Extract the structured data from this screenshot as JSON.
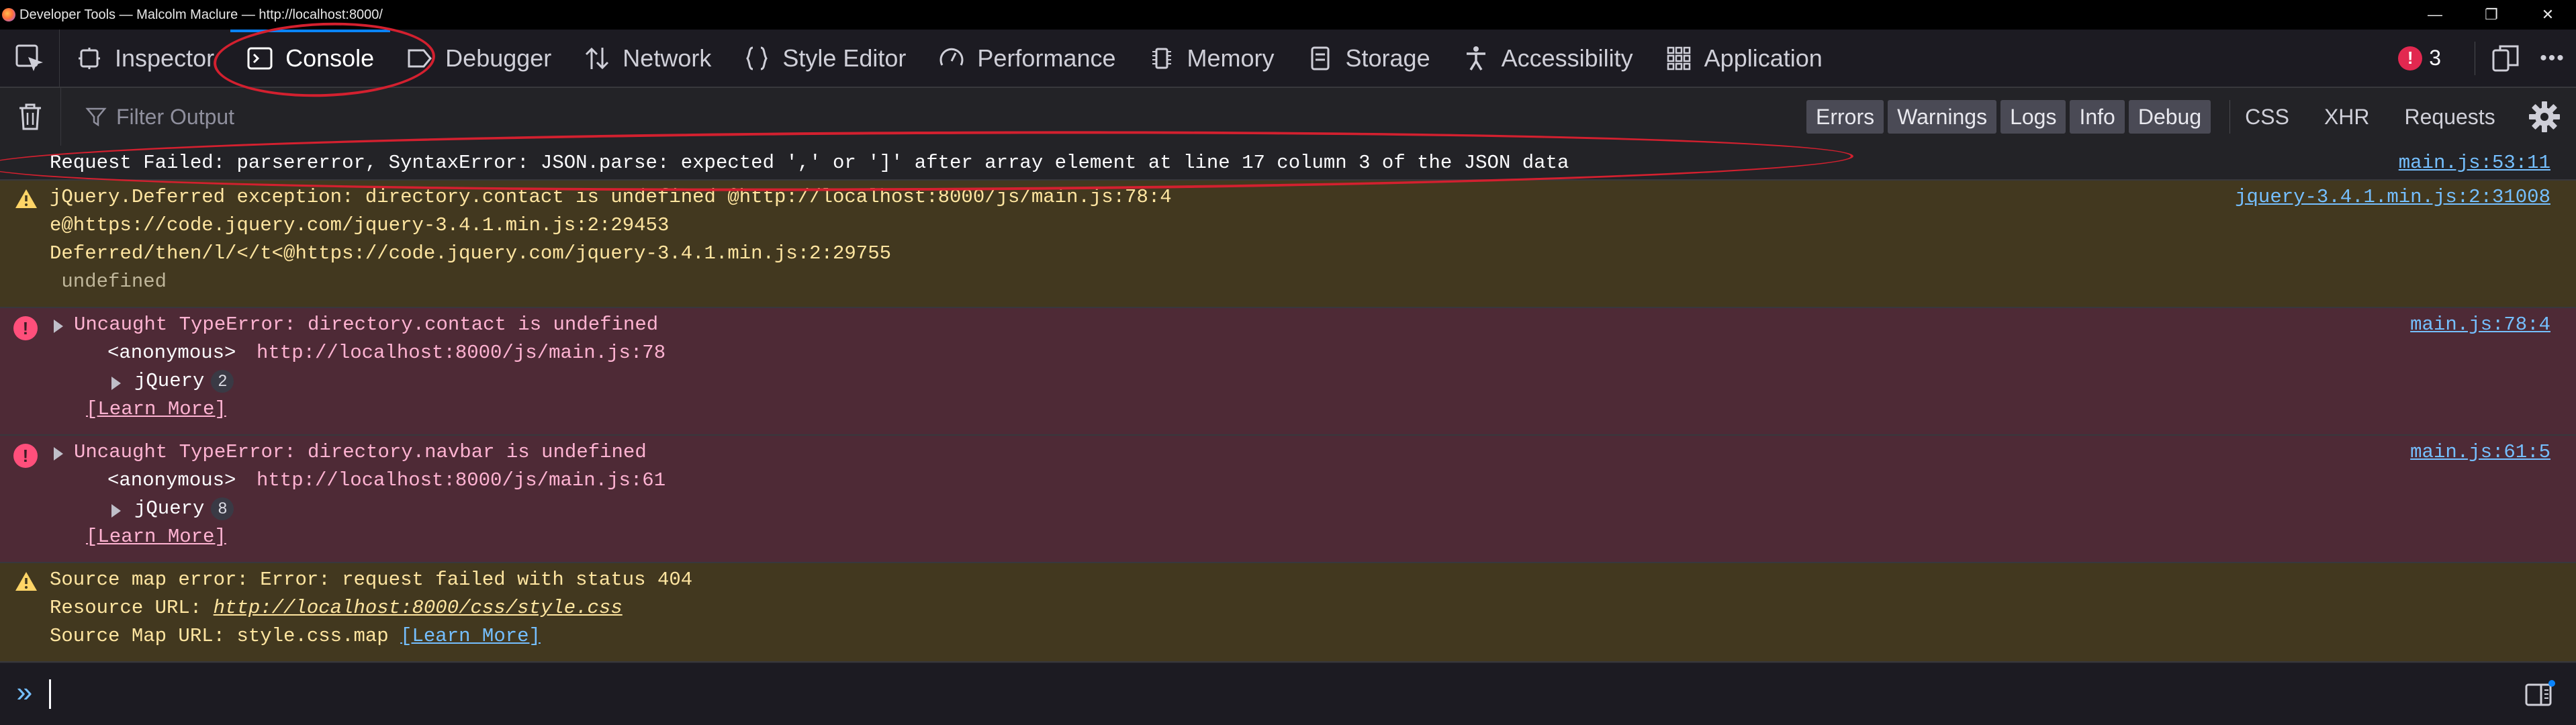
{
  "window": {
    "title": "Developer Tools — Malcolm Maclure — http://localhost:8000/",
    "controls": [
      "—",
      "❐",
      "✕"
    ]
  },
  "toolbar": {
    "tabs": [
      {
        "label": "Inspector",
        "icon": "inspector-icon"
      },
      {
        "label": "Console",
        "icon": "console-icon",
        "active": true
      },
      {
        "label": "Debugger",
        "icon": "debugger-icon"
      },
      {
        "label": "Network",
        "icon": "network-icon"
      },
      {
        "label": "Style Editor",
        "icon": "style-editor-icon"
      },
      {
        "label": "Performance",
        "icon": "performance-icon"
      },
      {
        "label": "Memory",
        "icon": "memory-icon"
      },
      {
        "label": "Storage",
        "icon": "storage-icon"
      },
      {
        "label": "Accessibility",
        "icon": "accessibility-icon"
      },
      {
        "label": "Application",
        "icon": "application-icon"
      }
    ],
    "error_count": "3",
    "more_label": "•••"
  },
  "filterbar": {
    "placeholder": "Filter Output",
    "levels": [
      "Errors",
      "Warnings",
      "Logs",
      "Info",
      "Debug"
    ],
    "net": [
      "CSS",
      "XHR",
      "Requests"
    ]
  },
  "messages": {
    "m1": {
      "text": "Request Failed: parsererror, SyntaxError: JSON.parse: expected ',' or ']' after array element at line 17 column 3 of the JSON data",
      "source": "main.js:53:11"
    },
    "m2": {
      "lines": [
        "jQuery.Deferred exception: directory.contact is undefined @http://localhost:8000/js/main.js:78:4",
        "e@https://code.jquery.com/jquery-3.4.1.min.js:2:29453",
        "Deferred/then/l/</t<@https://code.jquery.com/jquery-3.4.1.min.js:2:29755",
        " undefined"
      ],
      "source": "jquery-3.4.1.min.js:2:31008"
    },
    "m3": {
      "text": "Uncaught TypeError: directory.contact is undefined",
      "frame_name": "<anonymous>",
      "frame_url": "http://localhost:8000/js/main.js:78",
      "group": "jQuery",
      "group_count": "2",
      "learn_more": "[Learn More]",
      "source": "main.js:78:4"
    },
    "m4": {
      "text": "Uncaught TypeError: directory.navbar is undefined",
      "frame_name": "<anonymous>",
      "frame_url": "http://localhost:8000/js/main.js:61",
      "group": "jQuery",
      "group_count": "8",
      "learn_more": "[Learn More]",
      "source": "main.js:61:5"
    },
    "m5": {
      "text": "Source map error: Error: request failed with status 404",
      "resource_label": "Resource URL: ",
      "resource_url": "http://localhost:8000/css/style.css",
      "map_label": "Source Map URL: style.css.map ",
      "learn_more": "[Learn More]"
    }
  },
  "console_input": {
    "prompt": "»"
  },
  "colors": {
    "accent": "#0a84ff",
    "error": "#e22850",
    "annotation": "#d3202f"
  }
}
